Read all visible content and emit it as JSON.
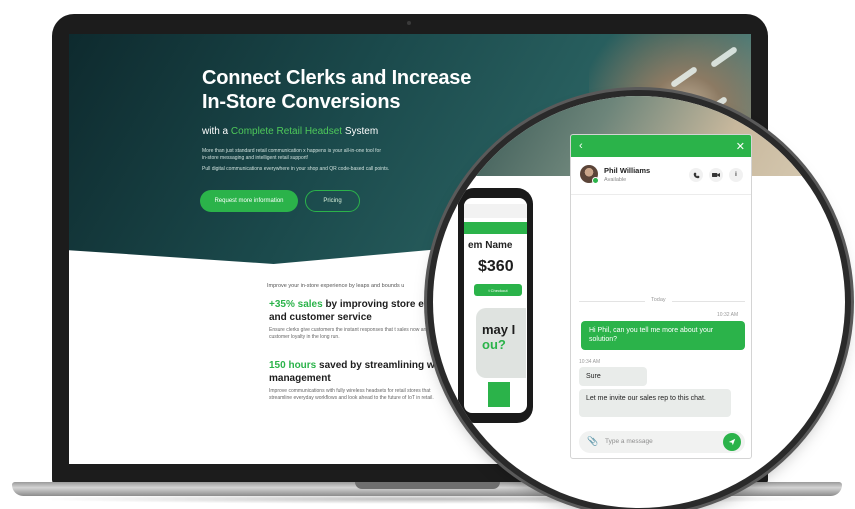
{
  "hero": {
    "title": "Connect Clerks and Increase In-Store Conversions",
    "subtitle_prefix": "with a",
    "subtitle_accent": "Complete Retail Headset",
    "subtitle_suffix": "System",
    "text_1": "More than just standard retail communication x happens is your all-in-one tool for",
    "text_2": "in-store messaging and intelligent retail support!",
    "text_3": "Pull digital communications everywhere in your shop and QR code-based call points.",
    "primary_button": "Request more information",
    "secondary_button": "Pricing"
  },
  "features": {
    "intro": "Improve your in-store experience by leaps and bounds u",
    "item1_green": "+35% sales",
    "item1_title": " by improving store effici",
    "item1_title_2": "and customer service",
    "item1_body": "Ensure clerks give customers the instant responses that t sales now and customer loyalty in the long run.",
    "item2_green": "150 hours",
    "item2_title": " saved by streamlining workfl",
    "item2_title_2": "management",
    "item2_body": "Improve communications with fully wireless headsets for retail stores that streamline everyday workflows and look ahead to the future of IoT in retail."
  },
  "phone": {
    "name": "em Name",
    "price": "$360",
    "button": "t Checkout",
    "ad_line1": "may I",
    "ad_line2": "ou?"
  },
  "chat": {
    "back_icon": "‹",
    "close_icon": "✕",
    "contact_name": "Phil Williams",
    "contact_status": "Available",
    "day_separator": "Today",
    "time_out": "10:32 AM",
    "msg_out": "Hi Phil, can you tell me more about your solution?",
    "time_in": "10:34 AM",
    "msg_in_1": "Sure",
    "msg_in_2": "Let me invite our sales rep to this chat.",
    "input_placeholder": "Type a message"
  },
  "colors": {
    "accent": "#2bb34a",
    "hero_dark": "#0e2a2e",
    "frame": "#1c1c1c"
  },
  "icons": {
    "phone": "phone-icon",
    "video": "video-icon",
    "info": "info-icon",
    "attach": "paperclip-icon",
    "send": "send-icon"
  }
}
